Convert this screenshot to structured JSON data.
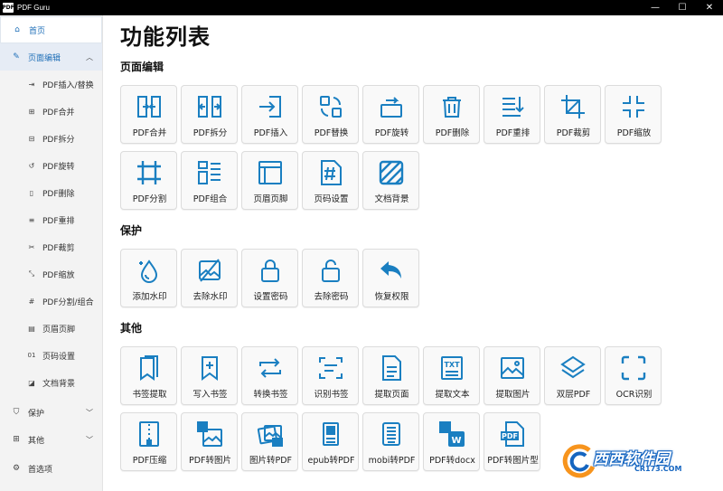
{
  "window": {
    "logo_text": "PDF",
    "title": "PDF Guru",
    "minimize": "—",
    "maximize": "☐",
    "close": "✕"
  },
  "sidebar": {
    "home": "首页",
    "page_edit": "页面编辑",
    "sub_items": [
      "PDF插入/替换",
      "PDF合并",
      "PDF拆分",
      "PDF旋转",
      "PDF删除",
      "PDF重排",
      "PDF裁剪",
      "PDF缩放",
      "PDF分割/组合",
      "页眉页脚",
      "页码设置",
      "文档背景"
    ],
    "protect": "保护",
    "other": "其他",
    "preferences": "首选项"
  },
  "main": {
    "title": "功能列表",
    "sections": {
      "edit": "页面编辑",
      "protect": "保护",
      "other": "其他"
    },
    "edit_tiles": [
      "PDF合并",
      "PDF拆分",
      "PDF插入",
      "PDF替换",
      "PDF旋转",
      "PDF删除",
      "PDF重排",
      "PDF裁剪",
      "PDF缩放",
      "PDF分割",
      "PDF组合",
      "页眉页脚",
      "页码设置",
      "文档背景"
    ],
    "protect_tiles": [
      "添加水印",
      "去除水印",
      "设置密码",
      "去除密码",
      "恢复权限"
    ],
    "other_tiles": [
      "书签提取",
      "写入书签",
      "转换书签",
      "识别书签",
      "提取页面",
      "提取文本",
      "提取图片",
      "双层PDF",
      "OCR识别",
      "PDF压缩",
      "PDF转图片",
      "图片转PDF",
      "epub转PDF",
      "mobi转PDF",
      "PDF转docx",
      "PDF转图片型"
    ]
  },
  "watermark": {
    "text": "西西软件园",
    "url": "CR173.COM"
  },
  "colors": {
    "icon": "#1a7fc1",
    "accent": "#1f6fb8"
  }
}
